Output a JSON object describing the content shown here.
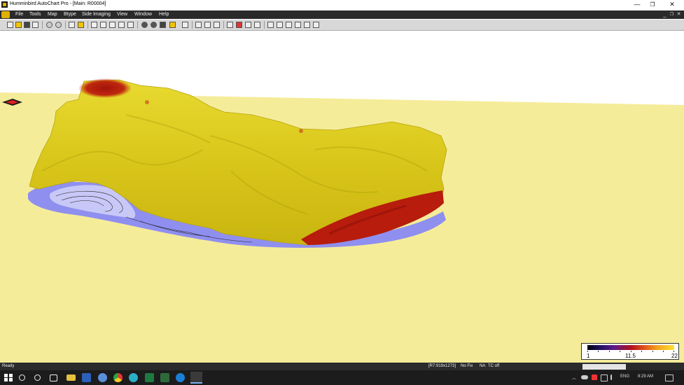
{
  "window": {
    "title": "Humminbird AutoChart Pro - [Main: R00004]",
    "minimize": "—",
    "restore": "❐",
    "close": "✕"
  },
  "menu": {
    "items": [
      "File",
      "Tools",
      "Map",
      "Btype",
      "Side Imaging",
      "View",
      "Window",
      "Help"
    ],
    "mdi_min": "_",
    "mdi_restore": "❐",
    "mdi_close": "✕"
  },
  "legend": {
    "min_label": "1",
    "mid_label": "11.5",
    "max_label": "22"
  },
  "status": {
    "left": "Ready",
    "info": "[R7:919x1273]",
    "fix": "No Fix",
    "na": "NA",
    "tc": "TC off"
  },
  "taskbar": {
    "time": "8:29 AM",
    "lang": "ENG"
  },
  "colors": {
    "map_bg": "#f5ec9a",
    "surface_yellow": "#dccb16",
    "deep_red": "#b71c0c",
    "shallow_blue": "#8f8ff0"
  },
  "icons": {
    "toolbar": [
      "new-icon",
      "open-icon",
      "save-icon",
      "print-icon",
      "zoom-in-icon",
      "zoom-out-icon",
      "layers-icon",
      "chart-icon",
      "route-icon",
      "waypoint-icon",
      "track-icon",
      "import-icon",
      "export-icon",
      "circle-icon",
      "sphere-icon",
      "square-icon",
      "cube-icon",
      "page-icon",
      "settings-icon",
      "shield-icon",
      "camera-icon",
      "flag-icon",
      "palette-icon",
      "pin-icon",
      "mark-icon",
      "grid-icon",
      "home-icon",
      "boat-icon",
      "gear-icon",
      "fish-icon",
      "pen-icon"
    ]
  }
}
